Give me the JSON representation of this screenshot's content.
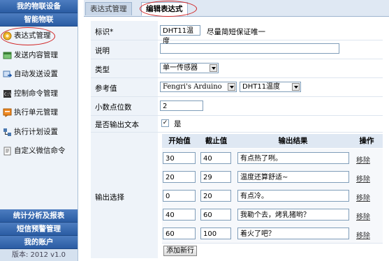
{
  "sidebar": {
    "section_iot": "我的物联设备",
    "section_smart": "智能物联",
    "items": [
      {
        "label": "表达式管理",
        "icon": "expression-icon"
      },
      {
        "label": "发送内容管理",
        "icon": "content-icon"
      },
      {
        "label": "自动发送设置",
        "icon": "auto-send-icon"
      },
      {
        "label": "控制命令管理",
        "icon": "command-icon"
      },
      {
        "label": "执行单元管理",
        "icon": "unit-icon"
      },
      {
        "label": "执行计划设置",
        "icon": "plan-icon"
      },
      {
        "label": "自定义微信命令",
        "icon": "wechat-command-icon"
      }
    ],
    "section_stats": "统计分析及报表",
    "section_sms": "短信预警管理",
    "section_account": "我的账户",
    "version": "版本: 2012 v1.0"
  },
  "tabs": [
    "表达式管理",
    "编辑表达式"
  ],
  "form": {
    "id_label": "标识*",
    "id_value": "DHT11温度",
    "id_hint": "尽量简短保证唯一",
    "desc_label": "说明",
    "desc_value": "",
    "type_label": "类型",
    "type_value": "单一传感器",
    "ref_label": "参考值",
    "ref_device": "Fengri's Arduino",
    "ref_sensor": "DHT11温度",
    "decimal_label": "小数点位数",
    "decimal_value": "2",
    "output_text_label": "是否输出文本",
    "output_text_check": "✓",
    "output_text_value": "是",
    "output_select_label": "输出选择"
  },
  "output_table": {
    "headers": [
      "开始值",
      "截止值",
      "输出结果",
      "操作"
    ],
    "rows": [
      {
        "start": "30",
        "end": "40",
        "result": "有点热了咧。",
        "action": "移除"
      },
      {
        "start": "20",
        "end": "29",
        "result": "温度还算舒适~",
        "action": "移除"
      },
      {
        "start": "0",
        "end": "20",
        "result": "有点冷。",
        "action": "移除"
      },
      {
        "start": "40",
        "end": "60",
        "result": "我勒个去，烤乳猪哟？",
        "action": "移除"
      },
      {
        "start": "60",
        "end": "100",
        "result": "着火了吧？",
        "action": "移除"
      }
    ],
    "add_button": "添加新行"
  }
}
